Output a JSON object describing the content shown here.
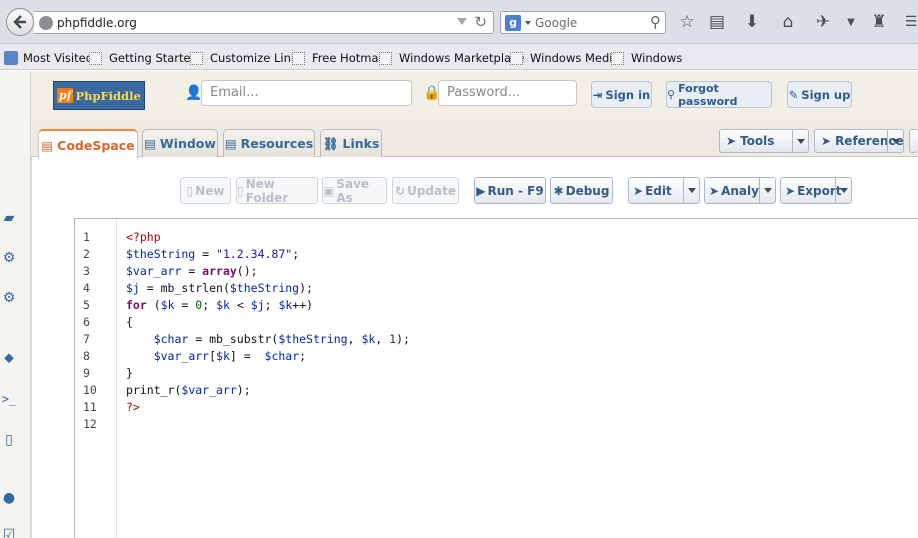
{
  "browser": {
    "url": "phpfiddle.org",
    "search_placeholder": "Google",
    "bookmarks": [
      "Most Visited",
      "Getting Started",
      "Customize Links",
      "Free Hotmail",
      "Windows Marketplace",
      "Windows Media",
      "Windows"
    ]
  },
  "site": {
    "logo_pf": "pf",
    "logo_word": "PhpFiddle",
    "email_placeholder": "Email...",
    "password_placeholder": "Password...",
    "sign_in": "Sign in",
    "forgot_password": "Forgot password",
    "sign_up": "Sign up"
  },
  "tabs": [
    {
      "label": "CodeSpace",
      "icon": "file-icon"
    },
    {
      "label": "Window",
      "icon": "window-icon"
    },
    {
      "label": "Resources",
      "icon": "document-icon"
    },
    {
      "label": "Links",
      "icon": "link-icon"
    }
  ],
  "tab_selects": {
    "tools": "Tools",
    "reference": "Reference"
  },
  "toolbar": {
    "new": "New",
    "new_folder": "New Folder",
    "save_as": "Save As",
    "update": "Update",
    "run": "Run - F9",
    "debug": "Debug",
    "edit": "Edit",
    "analy": "Analy",
    "export": "Export"
  },
  "editor": {
    "line_numbers": [
      "1",
      "2",
      "3",
      "4",
      "5",
      "6",
      "7",
      "8",
      "9",
      "10",
      "11",
      "12"
    ],
    "lines": [
      "<?php",
      "$theString = \"1.2.34.87\";",
      "$var_arr = array();",
      "$j = mb_strlen($theString);",
      "for ($k = 0; $k < $j; $k++)",
      "{",
      "    $char = mb_substr($theString, $k, 1);",
      "    $var_arr[$k] =  $char;",
      "}",
      "print_r($var_arr);",
      "?>",
      ""
    ]
  },
  "colors": {
    "accent_orange": "#ee8a3c",
    "link_blue": "#335c8b",
    "php_tag": "#b30000",
    "variable": "#0026a8"
  }
}
